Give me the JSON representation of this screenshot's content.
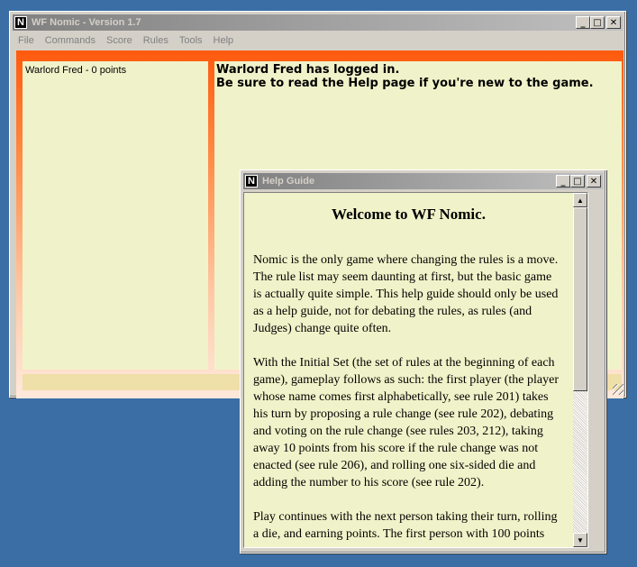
{
  "main_window": {
    "title": "WF Nomic - Version 1.7",
    "icon_letter": "N",
    "menu": [
      "File",
      "Commands",
      "Score",
      "Rules",
      "Tools",
      "Help"
    ],
    "players": [
      "Warlord Fred - 0 points"
    ],
    "chat_lines": [
      "Warlord Fred has logged in.",
      "Be sure to read the Help page if you're new to the game."
    ],
    "colors": {
      "accent": "#ff5a0e",
      "panel": "#f0f3c9",
      "input": "#efdfa8"
    }
  },
  "help_window": {
    "title": "Help Guide",
    "icon_letter": "N",
    "heading": "Welcome to WF Nomic.",
    "paragraphs": [
      "Nomic is the only game where changing the rules is a move. The rule list may seem daunting at first, but the basic game is actually quite simple. This help guide should only be used as a help guide, not for debating the rules, as rules (and Judges) change quite often.",
      "With the Initial Set (the set of rules at the beginning of each game), gameplay follows as such: the first player (the player whose name comes first alphabetically, see rule 201) takes his turn by proposing a rule change (see rule 202), debating and voting on the rule change (see rules 203, 212), taking away 10 points from his score if the rule change was not enacted (see rule 206), and rolling one six-sided die and adding the number to his score (see rule 202).",
      "Play continues with the next person taking their turn, rolling a die, and earning points. The first person with 100 points"
    ]
  },
  "caption_buttons": {
    "minimize": "_",
    "maximize": "□",
    "close": "✕"
  },
  "icons": [
    "app-icon",
    "minimize-icon",
    "maximize-icon",
    "close-icon",
    "scroll-up-icon",
    "scroll-down-icon",
    "resize-grip-icon"
  ]
}
